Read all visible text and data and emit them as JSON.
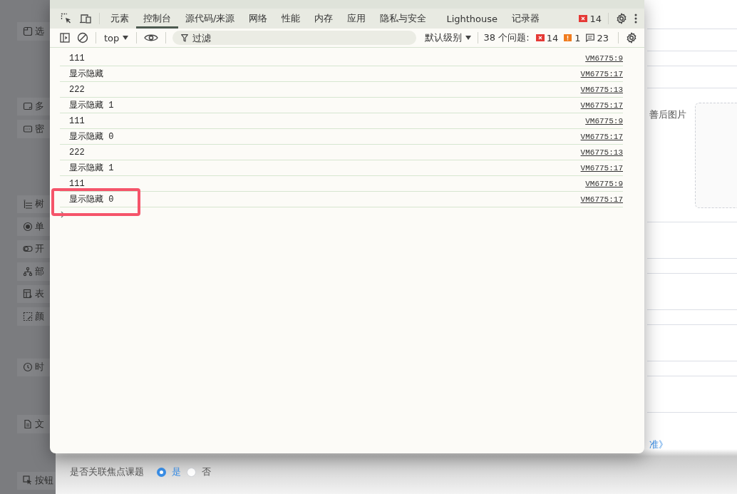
{
  "background_page": {
    "sidebar_items": [
      {
        "kind": "tab",
        "label": "选"
      },
      {
        "kind": "textarea",
        "label": "多"
      },
      {
        "kind": "password",
        "label": "密"
      },
      {
        "kind": "tree",
        "label": "树"
      },
      {
        "kind": "radio",
        "label": "单"
      },
      {
        "kind": "switch",
        "label": "开"
      },
      {
        "kind": "org",
        "label": "部"
      },
      {
        "kind": "table",
        "label": "表"
      },
      {
        "kind": "color",
        "label": "颜"
      },
      {
        "kind": "clock",
        "label": "时"
      },
      {
        "kind": "file",
        "label": "文"
      },
      {
        "kind": "pointer",
        "label": "按钮"
      }
    ],
    "image_label": "善后图片",
    "link": "准》",
    "question": {
      "label": "是否关联焦点课题",
      "options": [
        {
          "label": "是",
          "selected": true
        },
        {
          "label": "否",
          "selected": false
        }
      ]
    }
  },
  "devtools": {
    "tabs": [
      {
        "label": "元素",
        "selected": false
      },
      {
        "label": "控制台",
        "selected": true
      },
      {
        "label": "源代码/来源",
        "selected": false
      },
      {
        "label": "网络",
        "selected": false
      },
      {
        "label": "性能",
        "selected": false
      },
      {
        "label": "内存",
        "selected": false
      },
      {
        "label": "应用",
        "selected": false
      },
      {
        "label": "隐私与安全",
        "selected": false
      },
      {
        "label": "Lighthouse",
        "selected": false
      },
      {
        "label": "记录器",
        "selected": false
      }
    ],
    "error_badge": "14",
    "context": "top",
    "filter_placeholder": "过滤",
    "level": "默认级别",
    "issues_label": "38 个问题:",
    "issue_counts": [
      {
        "kind": "error",
        "count": "14"
      },
      {
        "kind": "warning",
        "count": "1"
      },
      {
        "kind": "info",
        "count": "23"
      }
    ],
    "messages": [
      {
        "text": "111",
        "source": "VM6775:9",
        "highlighted": false
      },
      {
        "text": "显示隐藏",
        "source": "VM6775:17",
        "highlighted": false
      },
      {
        "text": "222",
        "source": "VM6775:13",
        "highlighted": false
      },
      {
        "text": "显示隐藏 1",
        "source": "VM6775:17",
        "highlighted": false
      },
      {
        "text": "111",
        "source": "VM6775:9",
        "highlighted": false
      },
      {
        "text": "显示隐藏 0",
        "source": "VM6775:17",
        "highlighted": false
      },
      {
        "text": "222",
        "source": "VM6775:13",
        "highlighted": false
      },
      {
        "text": "显示隐藏 1",
        "source": "VM6775:17",
        "highlighted": false
      },
      {
        "text": "111",
        "source": "VM6775:9",
        "highlighted": false
      },
      {
        "text": "显示隐藏 0",
        "source": "VM6775:17",
        "highlighted": true
      }
    ]
  }
}
